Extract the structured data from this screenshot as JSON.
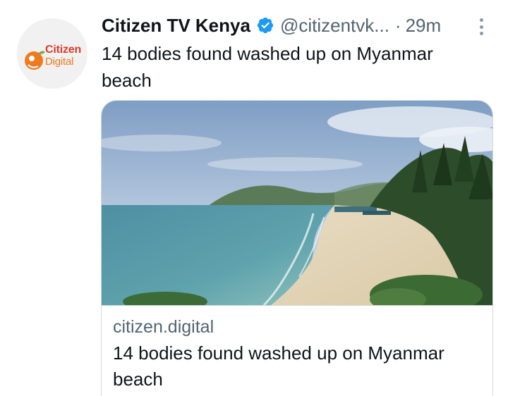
{
  "tweet": {
    "author": {
      "display_name": "Citizen TV Kenya",
      "handle": "@citizentvk...",
      "verified": true,
      "avatar_logo": {
        "line1": "Citizen",
        "line2": "Digital"
      }
    },
    "separator": "·",
    "timestamp": "29m",
    "text": "14 bodies found washed up on Myanmar beach",
    "more_icon": "more-vertical-icon",
    "card": {
      "domain": "citizen.digital",
      "title": "14 bodies found washed up on Myanmar beach",
      "image_subject": "beach"
    }
  },
  "colors": {
    "verified_badge": "#1d9bf0",
    "secondary_text": "#536471",
    "logo_red": "#e03a2a",
    "logo_orange": "#f07a1e",
    "logo_green": "#6ab04c",
    "card_border": "#cfd9de"
  }
}
